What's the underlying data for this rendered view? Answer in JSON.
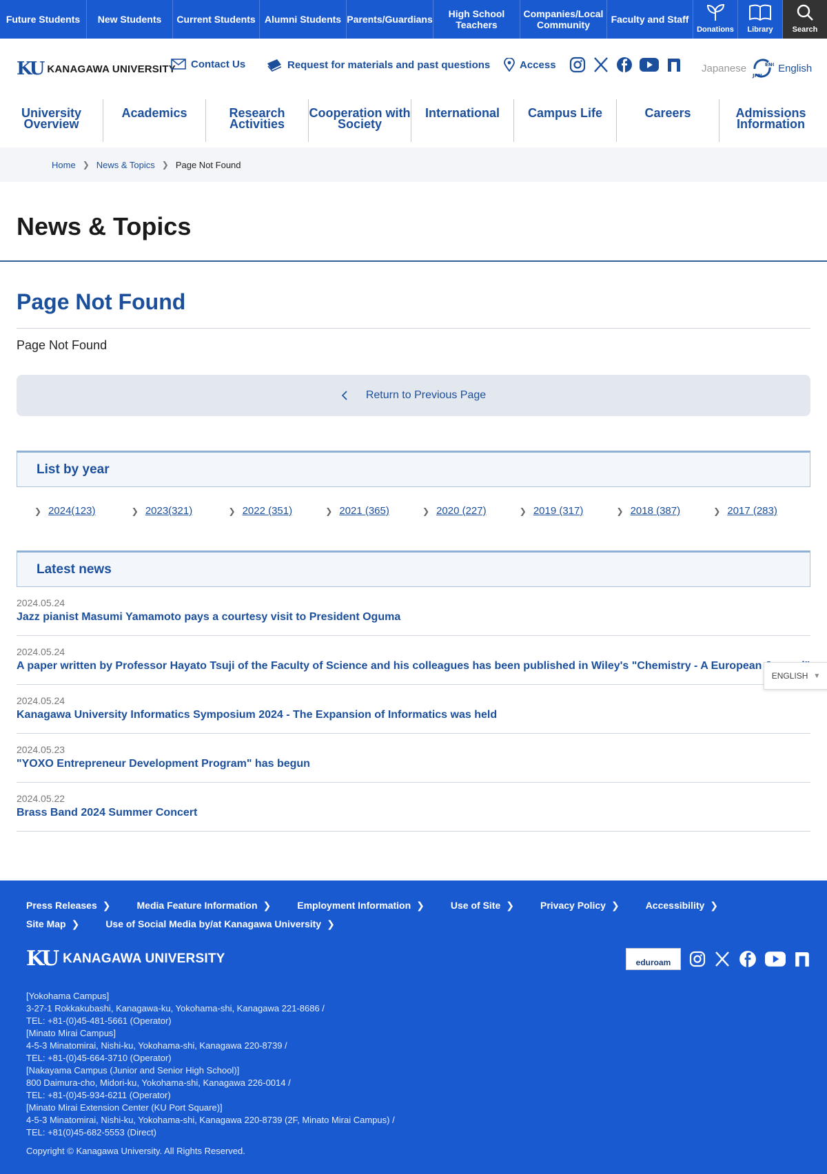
{
  "audience_bar": {
    "items": [
      "Future Students",
      "New Students",
      "Current Students",
      "Alumni Students",
      "Parents/Guardians",
      "High School\nTeachers",
      "Companies/Local\nCommunity",
      "Faculty and Staff"
    ],
    "donations": "Donations",
    "library": "Library",
    "search": "Search"
  },
  "header": {
    "logo_mark": "KU",
    "logo_name": "KANAGAWA UNIVERSITY",
    "contact": "Contact Us",
    "materials": "Request for materials and past questions",
    "access": "Access",
    "lang_ja": "Japanese",
    "lang_en": "English",
    "lang_badge_a": "ENG",
    "lang_badge_b": "JPN"
  },
  "main_nav": [
    "University\nOverview",
    "Academics",
    "Research\nActivities",
    "Cooperation with\nSociety",
    "International",
    "Campus Life",
    "Careers",
    "Admissions\nInformation"
  ],
  "breadcrumb": {
    "home": "Home",
    "news": "News & Topics",
    "current": "Page Not Found"
  },
  "page_title": "News & Topics",
  "not_found": {
    "heading": "Page Not Found",
    "text": "Page Not Found",
    "return": "Return to Previous Page"
  },
  "list_by_year": {
    "title": "List by year",
    "years": [
      "2024(123)",
      "2023(321)",
      "2022 (351)",
      "2021 (365)",
      "2020 (227)",
      "2019 (317)",
      "2018 (387)",
      "2017 (283)"
    ]
  },
  "latest_news": {
    "title": "Latest news",
    "items": [
      {
        "date": "2024.05.24",
        "title": "Jazz pianist Masumi Yamamoto pays a courtesy visit to President Oguma"
      },
      {
        "date": "2024.05.24",
        "title": "A paper written by Professor Hayato Tsuji of the Faculty of Science and his colleagues has been published in Wiley's \"Chemistry - A European Journal\""
      },
      {
        "date": "2024.05.24",
        "title": "Kanagawa University Informatics Symposium 2024 - The Expansion of Informatics was held"
      },
      {
        "date": "2024.05.23",
        "title": "\"YOXO Entrepreneur Development Program\" has begun"
      },
      {
        "date": "2024.05.22",
        "title": "Brass Band 2024 Summer Concert"
      }
    ]
  },
  "language_selector": "ENGLISH",
  "footer": {
    "links": [
      "Press Releases",
      "Media Feature Information",
      "Employment Information",
      "Use of Site",
      "Privacy Policy",
      "Accessibility",
      "Site Map",
      "Use of Social Media by/at Kanagawa University"
    ],
    "logo_mark": "KU",
    "logo_name": "KANAGAWA UNIVERSITY",
    "eduroam": "eduroam",
    "address_lines": [
      "[Yokohama Campus]",
      "3-27-1 Rokkakubashi, Kanagawa-ku, Yokohama-shi, Kanagawa 221-8686 /",
      "TEL: +81-(0)45-481-5661 (Operator)",
      "[Minato Mirai Campus]",
      "4-5-3 Minatomirai, Nishi-ku, Yokohama-shi, Kanagawa 220-8739 /",
      "TEL: +81-(0)45-664-3710 (Operator)",
      "[Nakayama Campus (Junior and Senior High School)]",
      "800 Daimura-cho, Midori-ku, Yokohama-shi, Kanagawa 226-0014 /",
      "TEL: +81-(0)45-934-6211 (Operator)",
      "[Minato Mirai Extension Center (KU Port Square)]",
      "4-5-3 Minatomirai, Nishi-ku, Yokohama-shi, Kanagawa 220-8739 (2F, Minato Mirai Campus) /",
      "TEL: +81(0)45-682-5553 (Direct)"
    ],
    "copyright": "Copyright © Kanagawa University. All Rights Reserved."
  },
  "colors": {
    "brand_blue": "#1a5ad1",
    "link_blue": "#1b4f9c",
    "search_bg": "#333333"
  }
}
